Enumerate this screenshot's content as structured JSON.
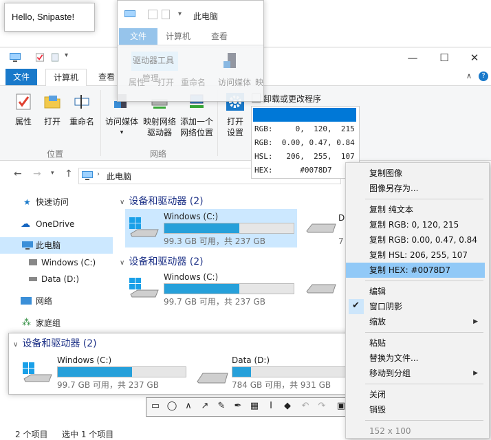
{
  "hello_snip": {
    "text": "Hello, Snipaste!"
  },
  "explorer": {
    "ribbon_tabs": {
      "file": "文件",
      "computer": "计算机",
      "view": "查看"
    },
    "ribbon": {
      "properties": "属性",
      "open": "打开",
      "rename": "重命名",
      "access_media_1": "访问媒体",
      "map_drive_1": "映射网络",
      "map_drive_2": "驱动器",
      "add_location_1": "添加一个",
      "add_location_2": "网络位置",
      "open_settings_1": "打开",
      "open_settings_2": "设置",
      "uninstall": "卸载或更改程序",
      "group_location": "位置",
      "group_network": "网络"
    },
    "address": {
      "path": "此电脑"
    },
    "nav": {
      "quick_access": "快速访问",
      "onedrive": "OneDrive",
      "this_pc": "此电脑",
      "windows_c": "Windows (C:)",
      "data_d": "Data (D:)",
      "network": "网络",
      "homegroup": "家庭组"
    },
    "content": {
      "group1": "设备和驱动器 (2)",
      "group2": "设备和驱动器 (2)",
      "drive1_name": "Windows (C:)",
      "drive1_size": "99.3 GB 可用，共 237 GB",
      "drive2_name": "Windows (C:)",
      "drive2_size": "99.7 GB 可用，共 237 GB",
      "drive1_fill": 0.58,
      "drive2_fill": 0.58
    },
    "status": {
      "items": "2 个项目",
      "selected": "选中 1 个项目"
    }
  },
  "snip2": {
    "title": "此电脑",
    "tabs": {
      "file": "文件",
      "computer": "计算机",
      "view": "查看"
    },
    "ribbon_items": [
      "驱动器工具",
      "管理",
      "属性",
      "打开",
      "重命名",
      "访问媒体",
      "映"
    ]
  },
  "color_info": {
    "rgb_int": "RGB:     0,  120,  215",
    "rgb_float": "RGB:  0.00, 0.47, 0.84",
    "hsl": "HSL:   206,  255,  107",
    "hex": "HEX:      #0078D7",
    "swatch": "#0078D7"
  },
  "snip3": {
    "group": "设备和驱动器 (2)",
    "drive_c_name": "Windows (C:)",
    "drive_c_size": "99.7 GB 可用，共 237 GB",
    "drive_c_fill": 0.58,
    "drive_d_name": "Data (D:)",
    "drive_d_size": "784 GB 可用，共 931 GB",
    "drive_d_fill": 0.16
  },
  "context_menu": {
    "copy_image": "复制图像",
    "save_image_as": "图像另存为...",
    "copy_plain_text": "复制 纯文本",
    "copy_rgb_int": "复制 RGB: 0, 120, 215",
    "copy_rgb_float": "复制 RGB: 0.00, 0.47, 0.84",
    "copy_hsl": "复制 HSL: 206, 255, 107",
    "copy_hex": "复制 HEX: #0078D7",
    "edit": "编辑",
    "window_shadow": "窗口阴影",
    "zoom": "缩放",
    "paste": "粘贴",
    "replace_with_file": "替换为文件...",
    "move_to_group": "移动到分组",
    "close": "关闭",
    "destroy": "销毁",
    "size": "152 x 100"
  },
  "colors": {
    "accent": "#0078D7",
    "highlight": "#91C9F7",
    "bar": "#26A0DA"
  }
}
